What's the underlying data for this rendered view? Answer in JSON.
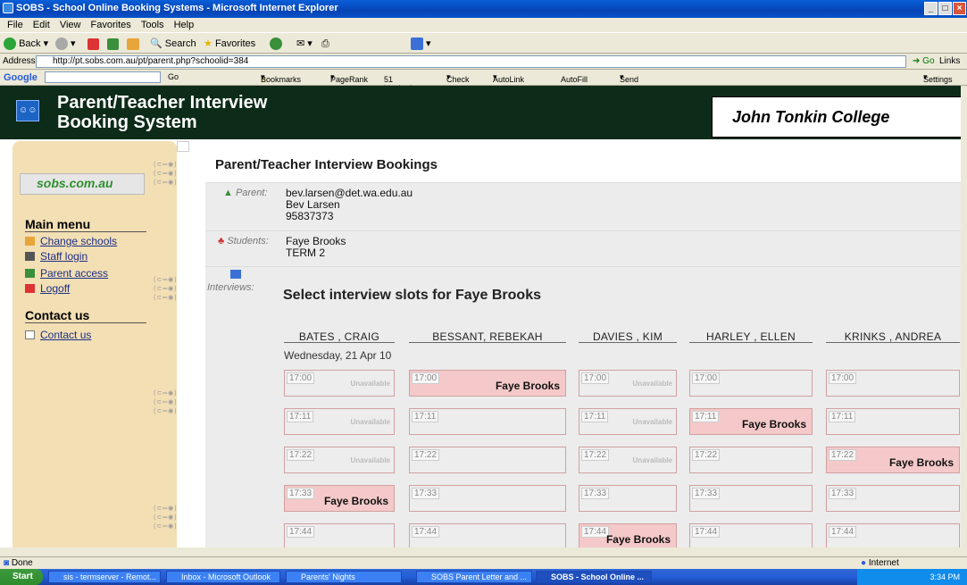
{
  "window": {
    "title": "SOBS - School Online Booking Systems - Microsoft Internet Explorer"
  },
  "menubar": [
    "File",
    "Edit",
    "View",
    "Favorites",
    "Tools",
    "Help"
  ],
  "toolbar": {
    "back": "Back",
    "search": "Search",
    "favorites": "Favorites"
  },
  "address": {
    "label": "Address",
    "url": "http://pt.sobs.com.au/pt/parent.php?schoolid=384",
    "go": "Go",
    "links": "Links"
  },
  "googlebar": {
    "logo": "Google",
    "go": "Go",
    "bookmarks": "Bookmarks",
    "pagerank": "PageRank",
    "blocked": "51 blocked",
    "check": "Check",
    "autolink": "AutoLink",
    "autofill": "AutoFill",
    "sendto": "Send to",
    "settings": "Settings"
  },
  "app": {
    "title_line1": "Parent/Teacher Interview",
    "title_line2": "Booking System",
    "college": "John Tonkin College"
  },
  "sidebar": {
    "logo_text": "sobs.com.au",
    "main_menu_heading": "Main menu",
    "items": [
      "Change schools",
      "Staff login",
      "Parent access",
      "Logoff"
    ],
    "contact_heading": "Contact us",
    "contact_item": "Contact us"
  },
  "main": {
    "page_title": "Parent/Teacher Interview Bookings",
    "parent_label": "Parent:",
    "parent_email": "bev.larsen@det.wa.edu.au",
    "parent_name": "Bev Larsen",
    "parent_phone": "95837373",
    "students_label": "Students:",
    "student_name": "Faye Brooks",
    "student_term": "TERM 2",
    "interviews_label": "Interviews:",
    "select_heading": "Select interview slots for Faye Brooks",
    "date": "Wednesday, 21 Apr 10",
    "teachers": [
      "BATES , CRAIG",
      "BESSANT, REBEKAH",
      "DAVIES , KIM",
      "HARLEY , ELLEN",
      "KRINKS , ANDREA"
    ],
    "times": [
      "17:00",
      "17:11",
      "17:22",
      "17:33",
      "17:44"
    ],
    "unavailable_label": "Unavailable",
    "grid": [
      [
        "unavailable",
        "booked",
        "unavailable",
        "",
        ""
      ],
      [
        "unavailable",
        "",
        "unavailable",
        "booked",
        ""
      ],
      [
        "unavailable",
        "",
        "unavailable",
        "",
        "booked"
      ],
      [
        "booked",
        "",
        "",
        "",
        ""
      ],
      [
        "",
        "",
        "booked",
        "",
        ""
      ]
    ],
    "booked_name": "Faye Brooks"
  },
  "status": {
    "left": "Done",
    "zone": "Internet"
  },
  "taskbar": {
    "start": "Start",
    "tasks": [
      "sis - termserver - Remot...",
      "Inbox - Microsoft Outlook",
      "Parents' Nights",
      "SOBS Parent Letter and ...",
      "SOBS - School Online ..."
    ],
    "clock": "3:34 PM"
  }
}
